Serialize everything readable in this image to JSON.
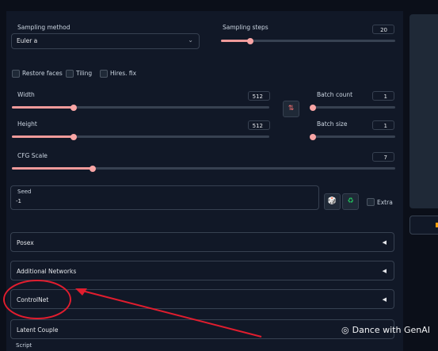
{
  "sampling": {
    "method_label": "Sampling method",
    "method_value": "Euler a",
    "steps_label": "Sampling steps",
    "steps_value": "20",
    "steps_fraction": 0.17
  },
  "options": {
    "restore_faces": "Restore faces",
    "tiling": "Tiling",
    "hires_fix": "Hires. fix"
  },
  "width": {
    "label": "Width",
    "value": "512",
    "fraction": 0.24
  },
  "height": {
    "label": "Height",
    "value": "512",
    "fraction": 0.24
  },
  "batch_count": {
    "label": "Batch count",
    "value": "1",
    "fraction": 0.0
  },
  "batch_size": {
    "label": "Batch size",
    "value": "1",
    "fraction": 0.0
  },
  "cfg": {
    "label": "CFG Scale",
    "value": "7",
    "fraction": 0.21
  },
  "seed": {
    "label": "Seed",
    "value": "-1",
    "extra": "Extra"
  },
  "accordions": {
    "posex": "Posex",
    "additional_networks": "Additional Networks",
    "controlnet": "ControlNet",
    "latent_couple": "Latent Couple",
    "script": "Script"
  },
  "icons": {
    "swap": "swap-dimensions-icon",
    "dice": "dice-icon",
    "recycle": "recycle-icon",
    "chevron": "chevron-down-icon",
    "arrow": "triangle-left-icon"
  },
  "watermark": "Dance with GenAI",
  "colors": {
    "accent": "#ef9a9a",
    "background": "#0b0f19",
    "panel": "#111827",
    "annotation": "#e11d2e"
  }
}
